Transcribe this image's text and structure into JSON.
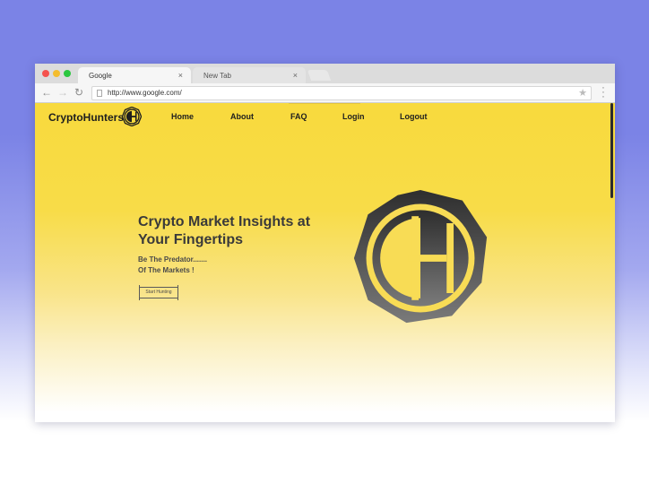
{
  "browser": {
    "tabs": [
      {
        "label": "Google",
        "close": "×"
      },
      {
        "label": "New Tab",
        "close": "×"
      }
    ],
    "url": "http://www.google.com/"
  },
  "site": {
    "brand": "CryptoHunters",
    "nav": [
      {
        "label": "Home"
      },
      {
        "label": "About"
      },
      {
        "label": "FAQ"
      },
      {
        "label": "Login"
      },
      {
        "label": "Logout"
      }
    ],
    "hero": {
      "title": "Crypto Market Insights at Your Fingertips",
      "subtitle_line1": "Be The Predator.......",
      "subtitle_line2": "Of The Markets !",
      "cta": "Start Hunting"
    }
  },
  "colors": {
    "background": "#7b83e6",
    "hero_yellow": "#f8da3d",
    "logo_dark": "#3a3a3a"
  },
  "icons": [
    "back-arrow-icon",
    "forward-arrow-icon",
    "reload-icon",
    "page-icon",
    "bookmark-star-icon",
    "kebab-menu-icon",
    "crypto-logo-icon"
  ]
}
